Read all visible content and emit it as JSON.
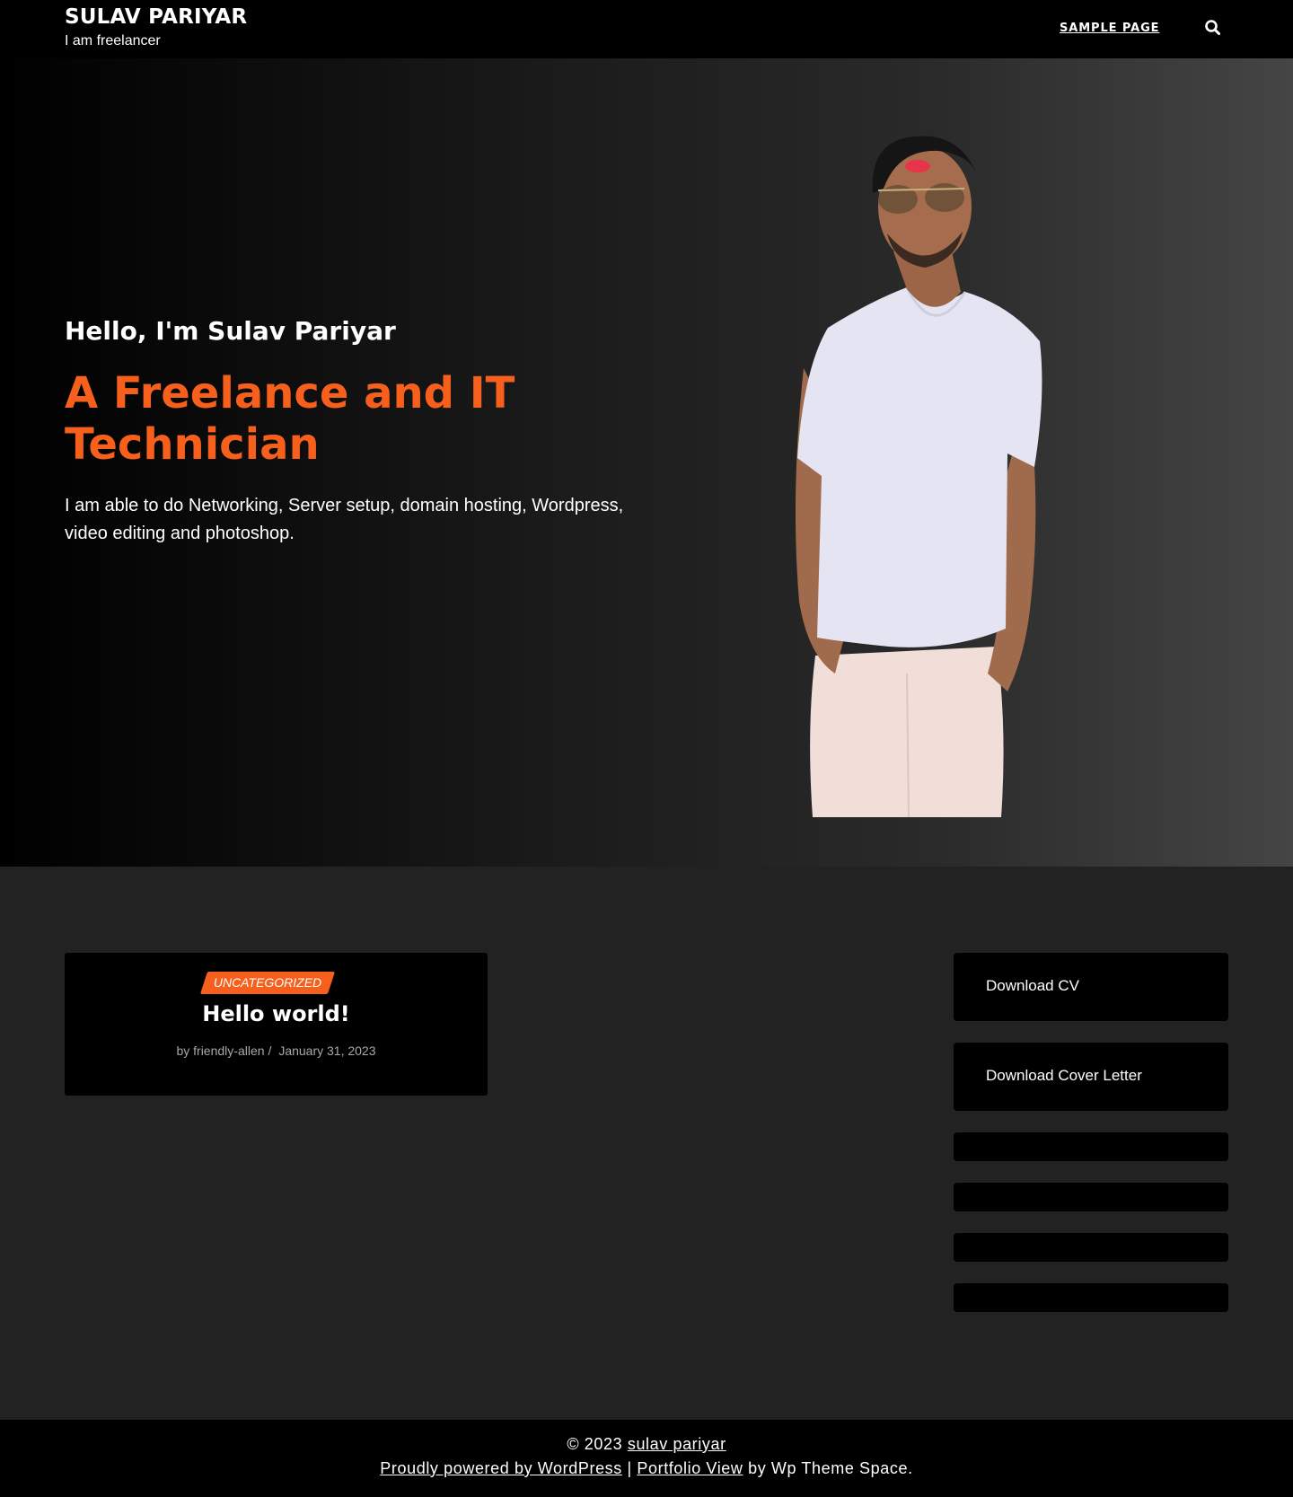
{
  "header": {
    "site_title": "SULAV PARIYAR",
    "tagline": "I am freelancer",
    "nav_items": [
      {
        "label": "SAMPLE PAGE"
      }
    ],
    "search_icon": "search-icon"
  },
  "hero": {
    "greeting": "Hello, I'm Sulav Pariyar",
    "title": "A Freelance and IT Technician",
    "description": "I am able to do Networking, Server setup, domain hosting, Wordpress, video editing and photoshop.",
    "accent_color": "#f7601c"
  },
  "post": {
    "category": "UNCATEGORIZED",
    "title": "Hello world!",
    "author": "by friendly-allen",
    "separator": "/",
    "date": "January 31, 2023"
  },
  "sidebar": {
    "buttons": [
      {
        "label": "Download CV"
      },
      {
        "label": "Download Cover Letter"
      }
    ]
  },
  "footer": {
    "copyright": "© 2023",
    "owner_link": "sulav pariyar",
    "powered_link": "Proudly powered by WordPress",
    "divider": "|",
    "theme_link": "Portfolio View",
    "theme_by": "by Wp Theme Space."
  }
}
